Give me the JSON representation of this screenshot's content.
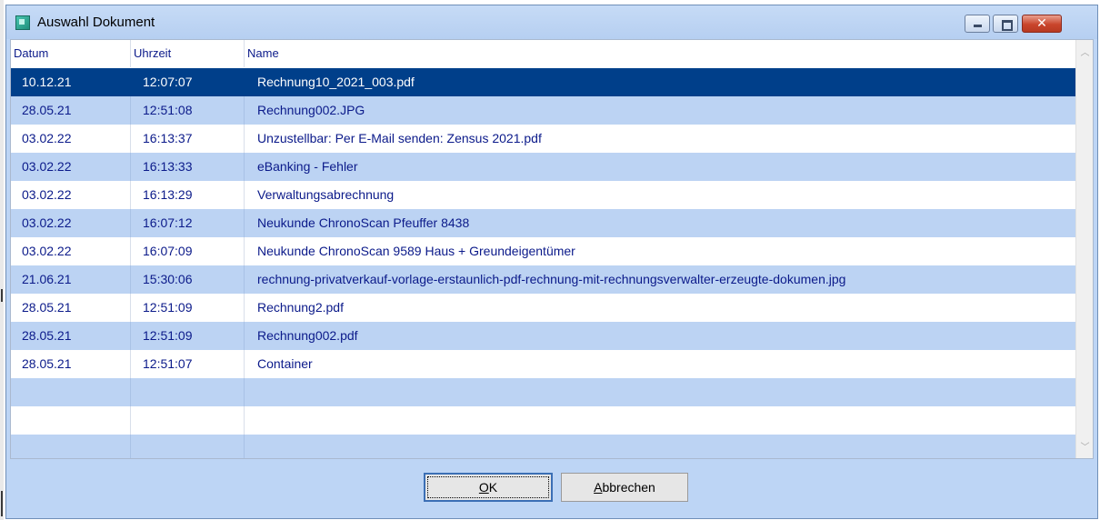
{
  "window": {
    "title": "Auswahl Dokument",
    "icon": "app-icon",
    "controls": {
      "minimize": "minimize-icon",
      "maximize": "maximize-icon",
      "close": "close-icon",
      "close_glyph": "✕"
    }
  },
  "table": {
    "columns": [
      "Datum",
      "Uhrzeit",
      "Name"
    ],
    "rows": [
      {
        "datum": "10.12.21",
        "uhrzeit": "12:07:07",
        "name": "Rechnung10_2021_003.pdf",
        "selected": true
      },
      {
        "datum": "28.05.21",
        "uhrzeit": "12:51:08",
        "name": "Rechnung002.JPG"
      },
      {
        "datum": "03.02.22",
        "uhrzeit": "16:13:37",
        "name": "Unzustellbar: Per E-Mail senden: Zensus 2021.pdf"
      },
      {
        "datum": "03.02.22",
        "uhrzeit": "16:13:33",
        "name": "eBanking - Fehler"
      },
      {
        "datum": "03.02.22",
        "uhrzeit": "16:13:29",
        "name": "Verwaltungsabrechnung"
      },
      {
        "datum": "03.02.22",
        "uhrzeit": "16:07:12",
        "name": "Neukunde ChronoScan Pfeuffer  8438"
      },
      {
        "datum": "03.02.22",
        "uhrzeit": "16:07:09",
        "name": "Neukunde ChronoScan  9589  Haus + Greundeigentümer"
      },
      {
        "datum": "21.06.21",
        "uhrzeit": "15:30:06",
        "name": "rechnung-privatverkauf-vorlage-erstaunlich-pdf-rechnung-mit-rechnungsverwalter-erzeugte-dokumen.jpg"
      },
      {
        "datum": "28.05.21",
        "uhrzeit": "12:51:09",
        "name": "Rechnung2.pdf"
      },
      {
        "datum": "28.05.21",
        "uhrzeit": "12:51:09",
        "name": "Rechnung002.pdf"
      },
      {
        "datum": "28.05.21",
        "uhrzeit": "12:51:07",
        "name": "Container"
      },
      {
        "datum": "",
        "uhrzeit": "",
        "name": ""
      },
      {
        "datum": "",
        "uhrzeit": "",
        "name": ""
      },
      {
        "datum": "",
        "uhrzeit": "",
        "name": ""
      }
    ]
  },
  "scrollbar": {
    "up_glyph": "︿",
    "down_glyph": "﹀"
  },
  "buttons": {
    "ok": {
      "mnemonic": "O",
      "rest": "K"
    },
    "cancel": {
      "mnemonic": "A",
      "rest": "bbrechen"
    }
  },
  "colors": {
    "selection": "#003f8a",
    "alt_row": "#bcd3f3",
    "text": "#0b1a8a",
    "window_bg": "#bdd5f5"
  }
}
